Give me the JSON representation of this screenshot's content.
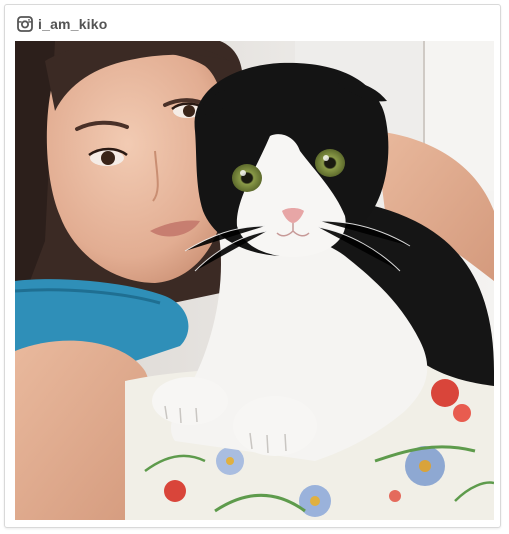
{
  "post": {
    "username": "i_am_kiko",
    "platform_icon": "instagram-icon"
  },
  "colors": {
    "username_text": "#545454",
    "card_border": "#d9d9d9",
    "background": "#ffffff"
  }
}
